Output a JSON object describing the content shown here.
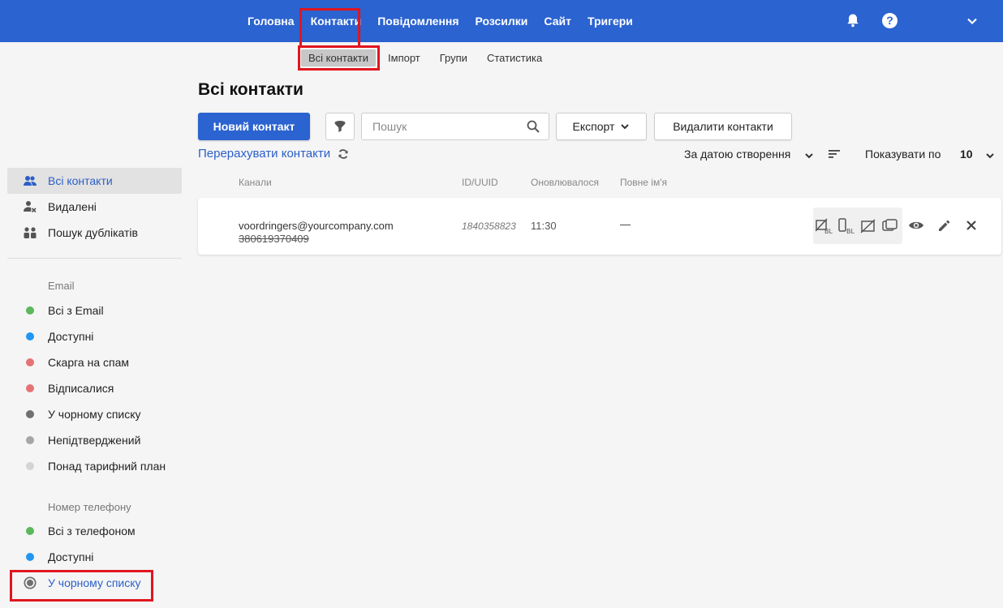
{
  "topnav": {
    "items": [
      "Головна",
      "Контакти",
      "Повідомлення",
      "Розсилки",
      "Сайт",
      "Тригери"
    ]
  },
  "subnav": {
    "items": [
      "Всі контакти",
      "Імпорт",
      "Групи",
      "Статистика"
    ]
  },
  "sidebar": {
    "main_items": [
      "Всі контакти",
      "Видалені",
      "Пошук дублікатів"
    ],
    "email_heading": "Email",
    "email_items": [
      {
        "label": "Всі з Email",
        "color": "#5cb85c"
      },
      {
        "label": "Доступні",
        "color": "#2196f3"
      },
      {
        "label": "Скарга на спам",
        "color": "#e57373"
      },
      {
        "label": "Відписалися",
        "color": "#e57373"
      },
      {
        "label": "У чорному списку",
        "color": "#707070"
      },
      {
        "label": "Непідтверджений",
        "color": "#a6a6a6"
      },
      {
        "label": "Понад тарифний план",
        "color": "#d4d4d4"
      }
    ],
    "phone_heading": "Номер телефону",
    "phone_items": [
      {
        "label": "Всі з телефоном",
        "color": "#5cb85c"
      },
      {
        "label": "Доступні",
        "color": "#2196f3"
      },
      {
        "label": "У чорному списку",
        "color": "#707070"
      }
    ]
  },
  "main": {
    "title": "Всі контакти",
    "new_contact": "Новий контакт",
    "search_placeholder": "Пошук",
    "export": "Експорт",
    "delete_contacts": "Видалити контакти",
    "recount": "Перерахувати контакти",
    "sort_label": "За датою створення",
    "show_label": "Показувати по",
    "show_value": "10",
    "columns": [
      "Канали",
      "ID/UUID",
      "Оновлювалося",
      "Повне ім'я"
    ]
  },
  "row": {
    "email": "voordringers@yourcompany.com",
    "phone": "380619370409",
    "id": "1840358823",
    "updated": "11:30",
    "fullname": "—"
  },
  "colors": {
    "brand": "#2b63d0",
    "highlight": "#e0161f"
  }
}
